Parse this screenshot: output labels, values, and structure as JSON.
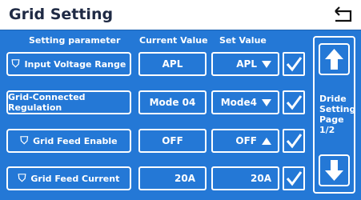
{
  "header": {
    "title": "Grid Setting",
    "back_icon": "return-arrow-icon"
  },
  "columns": {
    "parameter": "Setting parameter",
    "current": "Current Value",
    "set": "Set Value"
  },
  "rows": [
    {
      "parameter": "Input Voltage Range",
      "current": "APL",
      "set": "APL",
      "set_indicator": "dropdown-arrow-icon"
    },
    {
      "parameter": "Grid-Connected Regulation",
      "current": "Mode 04",
      "set": "Mode4",
      "set_indicator": "dropdown-arrow-icon"
    },
    {
      "parameter": "Grid Feed Enable",
      "current": "OFF",
      "set": "OFF",
      "set_indicator": "dropup-arrow-icon"
    },
    {
      "parameter": "Grid Feed Current",
      "current": "20A",
      "set": "20A",
      "set_indicator": "none"
    }
  ],
  "pager": {
    "line1": "Dride",
    "line2": "Setting",
    "line3": "Page",
    "line4": "1/2"
  },
  "colors": {
    "background": "#2478d6",
    "titlebar": "#ffffff",
    "foreground": "#ffffff"
  }
}
